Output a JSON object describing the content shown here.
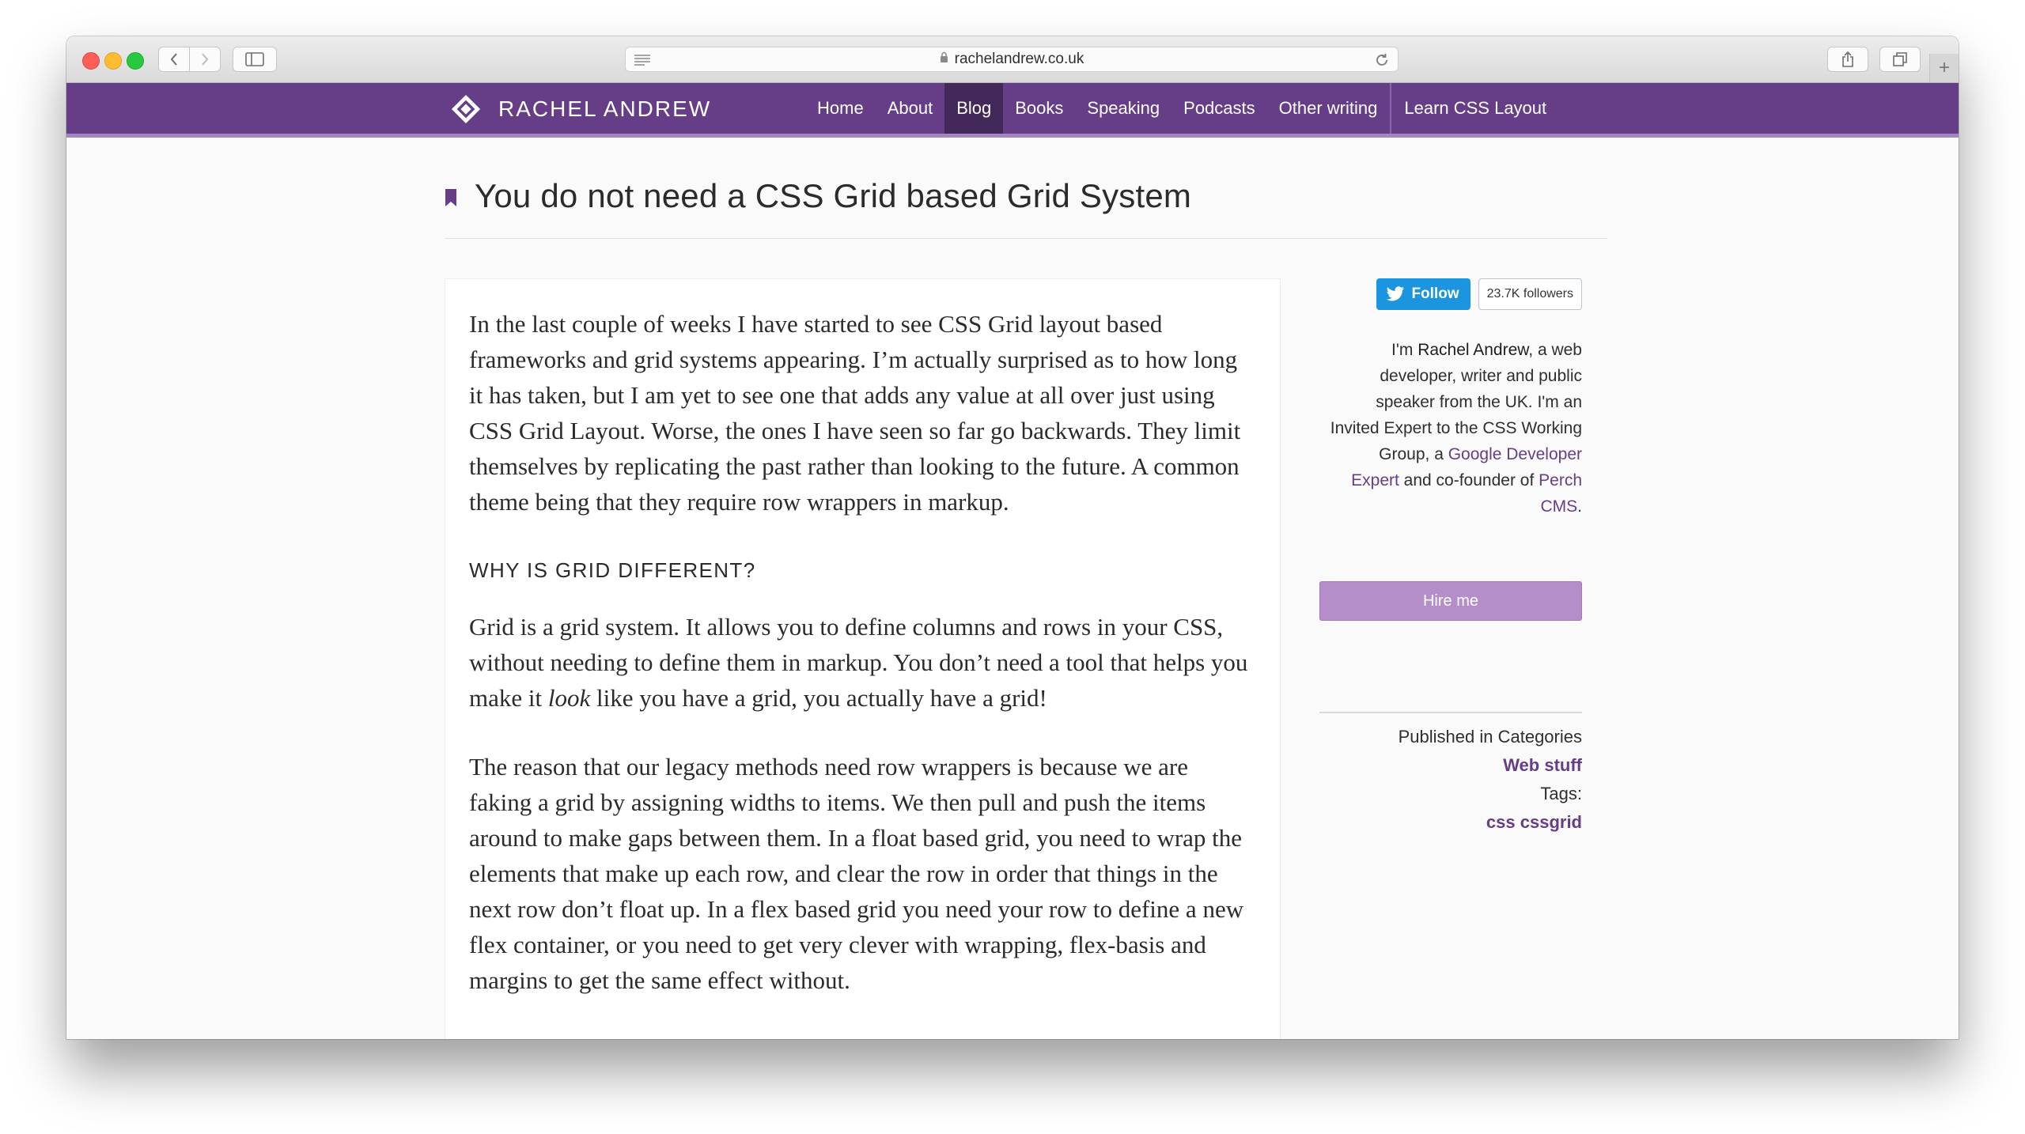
{
  "browser": {
    "url": "rachelandrew.co.uk"
  },
  "site": {
    "logo_text": "RACHEL ANDREW",
    "nav": [
      {
        "label": "Home"
      },
      {
        "label": "About"
      },
      {
        "label": "Blog",
        "active": true
      },
      {
        "label": "Books"
      },
      {
        "label": "Speaking"
      },
      {
        "label": "Podcasts"
      },
      {
        "label": "Other writing"
      },
      {
        "label": "Learn CSS Layout"
      }
    ],
    "colors": {
      "nav_bg": "#663e88",
      "nav_active_bg": "#42295a",
      "link": "#663e88",
      "hire_button": "#b38ec9",
      "twitter_blue": "#1b95e0"
    }
  },
  "post": {
    "title": "You do not need a CSS Grid based Grid System",
    "p1": "In the last couple of weeks I have started to see CSS Grid layout based frameworks and grid systems appearing. I’m actually surprised as to how long it has taken, but I am yet to see one that adds any value at all over just using CSS Grid Layout. Worse, the ones I have seen so far go backwards. They limit themselves by replicating the past rather than looking to the future. A common theme being that they require row wrappers in markup.",
    "h2": "WHY IS GRID DIFFERENT?",
    "p2_a": "Grid is a grid system. It allows you to define columns and rows in your CSS, without needing to define them in markup. You don’t need a tool that helps you make it ",
    "p2_em": "look",
    "p2_b": " like you have a grid, you actually have a grid!",
    "p3": "The reason that our legacy methods need row wrappers is because we are faking a grid by assigning widths to items. We then pull and push the items around to make gaps between them. In a float based grid, you need to wrap the elements that make up each row, and clear the row in order that things in the next row don’t float up. In a flex based grid you need your row to define a new flex container, or you need to get very clever with wrapping, flex-basis and margins to get the same effect without."
  },
  "sidebar": {
    "follow_label": "Follow",
    "followers": "23.7K followers",
    "bio": {
      "t1": "I'm ",
      "name": "Rachel Andrew",
      "t2": ", a web developer, writer and public speaker from the UK. I'm an Invited Expert to the CSS Working Group, a ",
      "link1": "Google Developer Expert",
      "t3": " and co-founder of ",
      "link2": "Perch CMS",
      "t4": "."
    },
    "hire_label": "Hire me",
    "published_label": "Published in Categories",
    "category": "Web stuff",
    "tags_label": "Tags:",
    "tags": [
      "css",
      "cssgrid"
    ]
  }
}
